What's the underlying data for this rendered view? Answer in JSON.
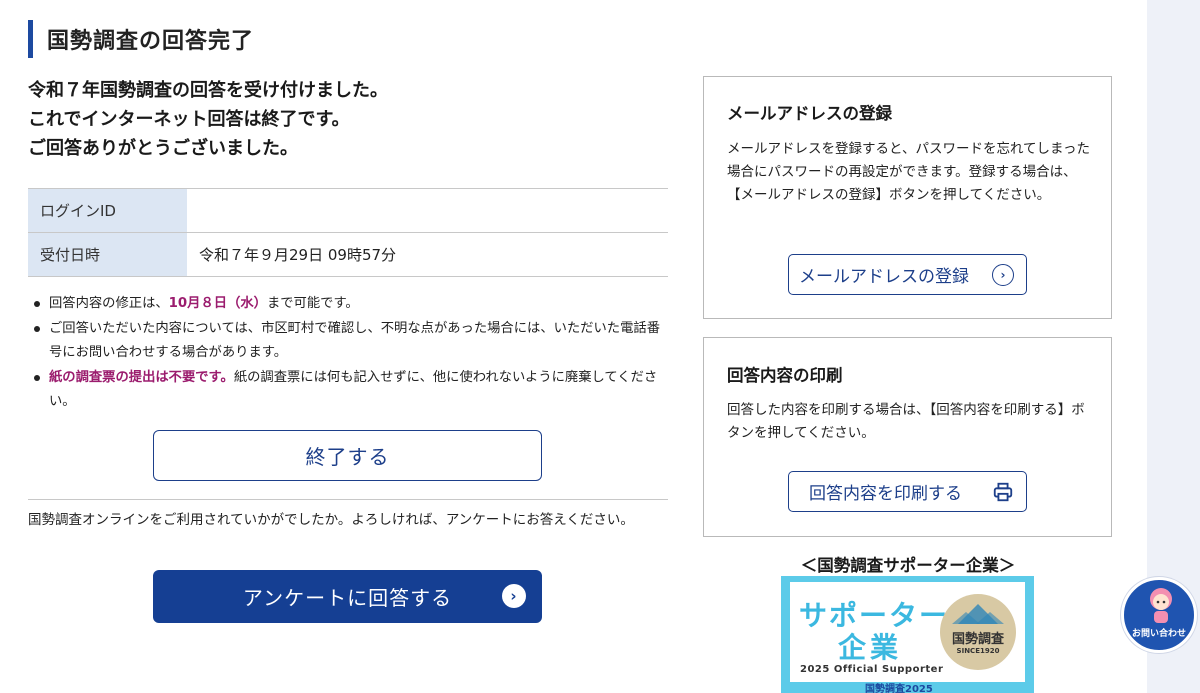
{
  "page": {
    "title": "国勢調査の回答完了",
    "intro_lines": [
      "令和７年国勢調査の回答を受け付けました。",
      "これでインターネット回答は終了です。",
      "ご回答ありがとうございました。"
    ]
  },
  "info_table": {
    "login_label": "ログインID",
    "login_value": "",
    "received_label": "受付日時",
    "received_value": "令和７年９月29日 09時57分"
  },
  "notes": {
    "note1_a": "回答内容の修正は、",
    "note1_hl": "10月８日（水）",
    "note1_b": "まで可能です。",
    "note2": "ご回答いただいた内容については、市区町村で確認し、不明な点があった場合には、いただいた電話番号にお問い合わせする場合があります。",
    "note3_hl": "紙の調査票の提出は不要です。",
    "note3_b": "紙の調査票には何も記入せずに、他に使われないように廃棄してください。"
  },
  "buttons": {
    "end_label": "終了する",
    "survey_label": "アンケートに回答する",
    "mail_label": "メールアドレスの登録",
    "print_label": "回答内容を印刷する"
  },
  "survey": {
    "text": "国勢調査オンラインをご利用されていかがでしたか。よろしければ、アンケートにお答えください。"
  },
  "mail_panel": {
    "heading": "メールアドレスの登録",
    "body": "メールアドレスを登録すると、パスワードを忘れてしまった場合にパスワードの再設定ができます。登録する場合は、【メールアドレスの登録】ボタンを押してください。"
  },
  "print_panel": {
    "heading": "回答内容の印刷",
    "body": "回答した内容を印刷する場合は、【回答内容を印刷する】ボタンを押してください。"
  },
  "supporter": {
    "heading": "＜国勢調査サポーター企業＞",
    "banner_line1": "サポーター",
    "banner_line2": "企業",
    "banner_line3": "2025 Official Supporter",
    "seal_text": "国勢調査",
    "seal_sub": "SINCE1920",
    "banner_footer": "国勢調査2025"
  },
  "help": {
    "label": "お問い合わせ"
  },
  "colors": {
    "accent_navy": "#1d3f8a",
    "primary_button": "#153f93",
    "highlight_magenta": "#9b1c6e",
    "table_header_bg": "#dce6f3",
    "banner_cyan": "#5ccbe9"
  },
  "icons": [
    "chevron-right-circle-icon",
    "printer-icon",
    "help-character-icon"
  ]
}
